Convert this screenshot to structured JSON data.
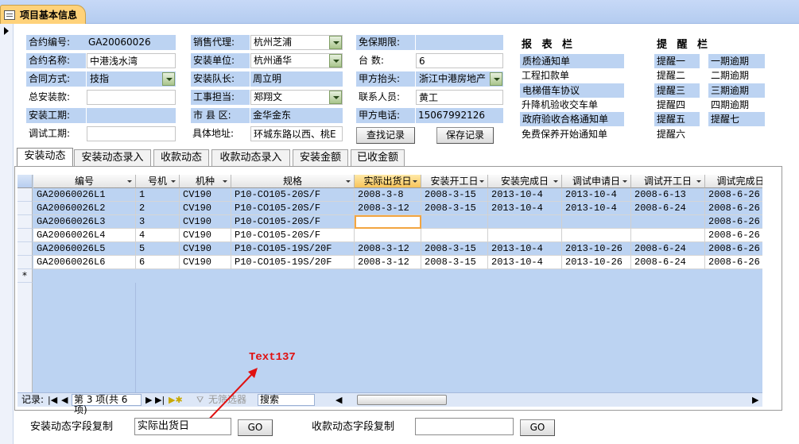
{
  "window": {
    "title": "项目基本信息"
  },
  "contract": {
    "number_label": "合约编号:",
    "number_value": "GA20060026",
    "name_label": "合约名称:",
    "name_value": "中港浅水湾",
    "method_label": "合同方式:",
    "method_value": "技指",
    "total_label": "总安装款:",
    "total_value": "",
    "install_period_label": "安装工期:",
    "install_period_value": "",
    "debug_period_label": "调试工期:",
    "debug_period_value": ""
  },
  "sales": {
    "agent_label": "销售代理:",
    "agent_value": "杭州芝浦",
    "install_unit_label": "安装单位:",
    "install_unit_value": "杭州通华",
    "team_leader_label": "安装队长:",
    "team_leader_value": "周立明",
    "supervisor_label": "工事担当:",
    "supervisor_value": "郑翔文",
    "district_label": "市 县 区:",
    "district_value": "金华金东",
    "address_label": "具体地址:",
    "address_value": "环城东路以西、桃E"
  },
  "party": {
    "warranty_label": "免保期限:",
    "warranty_value": "",
    "units_label": "台    数:",
    "units_value": "6",
    "header_label": "甲方抬头:",
    "header_value": "浙江中港房地产",
    "contact_label": "联系人员:",
    "contact_value": "黄工",
    "phone_label": "甲方电话:",
    "phone_value": "15067992126",
    "find_button": "查找记录",
    "save_button": "保存记录"
  },
  "reports": {
    "header": "报 表 栏",
    "items": [
      "质检通知单",
      "工程扣款单",
      "电梯借车协议",
      "升降机验收交车单",
      "政府验收合格通知单",
      "免费保养开始通知单"
    ]
  },
  "reminders": {
    "header": "提 醒 栏",
    "left": [
      "提醒一",
      "提醒二",
      "提醒三",
      "提醒四",
      "提醒五",
      "提醒六"
    ],
    "right": [
      "一期逾期",
      "二期逾期",
      "三期逾期",
      "四期逾期",
      "提醒七"
    ]
  },
  "tabs": [
    "安装动态",
    "安装动态录入",
    "收款动态",
    "收款动态录入",
    "安装金额",
    "已收金额"
  ],
  "grid": {
    "columns": [
      "编号",
      "号机",
      "机种",
      "规格",
      "实际出货日",
      "安装开工日",
      "安装完成日",
      "调试申请日",
      "调试开工日",
      "调试完成日"
    ],
    "rows": [
      [
        "GA20060026L1",
        "1",
        "CV190",
        "P10-CO105-20S/F",
        "2008-3-8",
        "2008-3-15",
        "2013-10-4",
        "2013-10-4",
        "2008-6-13",
        "2008-6-26"
      ],
      [
        "GA20060026L2",
        "2",
        "CV190",
        "P10-CO105-20S/F",
        "2008-3-12",
        "2008-3-15",
        "2013-10-4",
        "2013-10-4",
        "2008-6-24",
        "2008-6-26"
      ],
      [
        "GA20060026L3",
        "3",
        "CV190",
        "P10-CO105-20S/F",
        "",
        "",
        "",
        "",
        "",
        "2008-6-26"
      ],
      [
        "GA20060026L4",
        "4",
        "CV190",
        "P10-CO105-20S/F",
        "",
        "",
        "",
        "",
        "",
        "2008-6-26"
      ],
      [
        "GA20060026L5",
        "5",
        "CV190",
        "P10-CO105-19S/20F",
        "2008-3-12",
        "2008-3-15",
        "2013-10-4",
        "2013-10-26",
        "2008-6-24",
        "2008-6-26"
      ],
      [
        "GA20060026L6",
        "6",
        "CV190",
        "P10-CO105-19S/20F",
        "2008-3-12",
        "2008-3-15",
        "2013-10-4",
        "2013-10-26",
        "2008-6-24",
        "2008-6-26"
      ]
    ],
    "new_row_marker": "*"
  },
  "navigation": {
    "label": "记录:",
    "position": "第 3 项(共 6 项)",
    "filter": "无筛选器",
    "search": "搜索"
  },
  "annotation": "Text137",
  "bottom": {
    "install_copy_label": "安装动态字段复制",
    "install_copy_value": "实际出货日",
    "go1": "GO",
    "payment_copy_label": "收款动态字段复制",
    "payment_copy_value": "",
    "go2": "GO"
  }
}
